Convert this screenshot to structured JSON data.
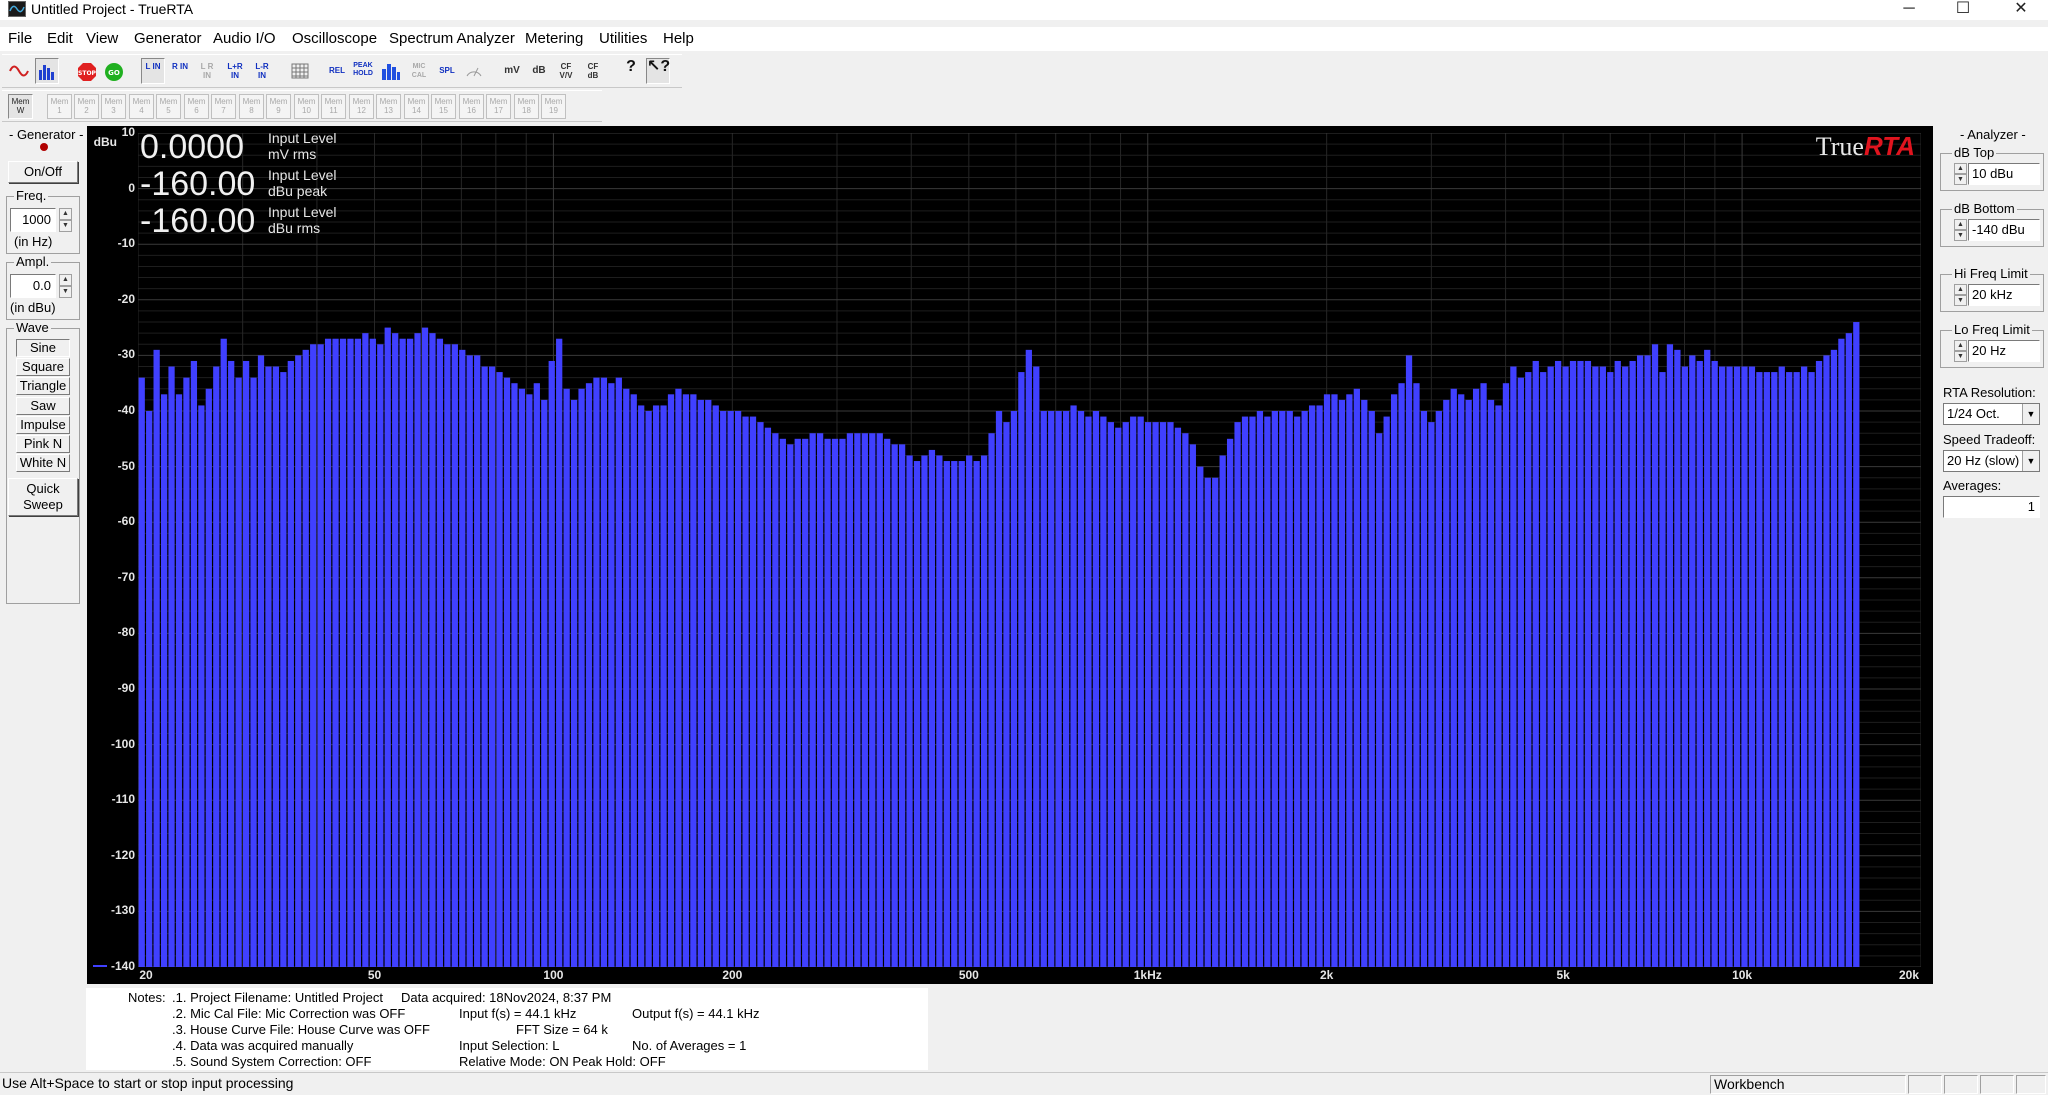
{
  "window": {
    "title": "Untitled Project - TrueRTA",
    "controls": {
      "minimize": "─",
      "maximize": "☐",
      "close": "✕"
    }
  },
  "menu": [
    "File",
    "Edit",
    "View",
    "Generator",
    "Audio I/O",
    "Oscilloscope",
    "Spectrum Analyzer",
    "Metering",
    "Utilities",
    "Help"
  ],
  "toolbar": {
    "buttons": [
      {
        "name": "osc-view-button",
        "icon": "sine-wave-icon"
      },
      {
        "name": "rta-view-button",
        "icon": "spectrum-bars-icon"
      },
      {
        "name": "stop-button",
        "label": "STOP"
      },
      {
        "name": "go-button",
        "label": "GO"
      },
      {
        "name": "l-in-button",
        "label": "L IN"
      },
      {
        "name": "r-in-button",
        "label": "R IN"
      },
      {
        "name": "l-r-in-disabled-button",
        "label": "L R IN"
      },
      {
        "name": "l-plus-r-in-button",
        "label": "L+R IN"
      },
      {
        "name": "l-minus-r-in-button",
        "label": "L-R IN"
      },
      {
        "name": "grid-button",
        "icon": "grid-icon"
      },
      {
        "name": "rel-button",
        "label": "REL"
      },
      {
        "name": "peak-hold-button",
        "label": "PEAK HOLD"
      },
      {
        "name": "bars-button",
        "icon": "bars-icon"
      },
      {
        "name": "mic-cal-button",
        "label": "MIC CAL"
      },
      {
        "name": "spl-button",
        "label": "SPL"
      },
      {
        "name": "meter-button",
        "icon": "meter-icon"
      },
      {
        "name": "mv-button",
        "label": "mV"
      },
      {
        "name": "db-button",
        "label": "dB"
      },
      {
        "name": "cf-vv-button",
        "label": "CF V/V"
      },
      {
        "name": "cf-db-button",
        "label": "CF dB"
      },
      {
        "name": "help-button",
        "icon": "question-icon"
      },
      {
        "name": "context-help-button",
        "icon": "context-help-icon"
      }
    ],
    "mem_buttons": [
      "Mem W",
      "Mem 1",
      "Mem 2",
      "Mem 3",
      "Mem 4",
      "Mem 5",
      "Mem 6",
      "Mem 7",
      "Mem 8",
      "Mem 9",
      "Mem 10",
      "Mem 11",
      "Mem 12",
      "Mem 13",
      "Mem 14",
      "Mem 15",
      "Mem 16",
      "Mem 17",
      "Mem 18",
      "Mem 19"
    ]
  },
  "generator": {
    "title": "- Generator -",
    "on_off": "On/Off",
    "freq_label": "Freq.",
    "freq_value": "1000",
    "freq_unit": "(in Hz)",
    "ampl_label": "Ampl.",
    "ampl_value": "0.0",
    "ampl_unit": "(in dBu)",
    "wave_label": "Wave",
    "waves": [
      "Sine",
      "Square",
      "Triangle",
      "Saw",
      "Impulse",
      "Pink N",
      "White N"
    ],
    "selected_wave": "Sine",
    "quick_sweep": "Quick Sweep"
  },
  "readouts": [
    {
      "value": "0.0000",
      "label1": "Input Level",
      "label2": "mV rms"
    },
    {
      "value": "-160.00",
      "label1": "Input Level",
      "label2": "dBu peak"
    },
    {
      "value": "-160.00",
      "label1": "Input Level",
      "label2": "dBu rms"
    }
  ],
  "logo": {
    "part1": "True",
    "part2": "RTA"
  },
  "colors": {
    "bars": "#4040ff",
    "plot_bg": "#000000",
    "logo_accent": "#e0141e"
  },
  "analyzer": {
    "title": "- Analyzer -",
    "db_top_label": "dB Top",
    "db_top": "10 dBu",
    "db_bottom_label": "dB Bottom",
    "db_bottom": "-140 dBu",
    "hi_freq_label": "Hi Freq Limit",
    "hi_freq": "20 kHz",
    "lo_freq_label": "Lo Freq Limit",
    "lo_freq": "20 Hz",
    "resolution_label": "RTA Resolution:",
    "resolution": "1/24 Oct.",
    "speed_label": "Speed Tradeoff:",
    "speed": "20 Hz (slow)",
    "averages_label": "Averages:",
    "averages": "1"
  },
  "chart_data": {
    "type": "bar",
    "ylabel": "dBu",
    "ylim": [
      -140,
      10
    ],
    "xlim": [
      20,
      20000
    ],
    "x_scale": "log",
    "grid": true,
    "y_ticks": [
      "10",
      "0",
      "-10",
      "-20",
      "-30",
      "-40",
      "-50",
      "-60",
      "-70",
      "-80",
      "-90",
      "-100",
      "-110",
      "-120",
      "-130",
      "-140"
    ],
    "x_ticks": [
      {
        "label": "20",
        "f": 20
      },
      {
        "label": "50",
        "f": 50
      },
      {
        "label": "100",
        "f": 100
      },
      {
        "label": "200",
        "f": 200
      },
      {
        "label": "500",
        "f": 500
      },
      {
        "label": "1kHz",
        "f": 1000
      },
      {
        "label": "2k",
        "f": 2000
      },
      {
        "label": "5k",
        "f": 5000
      },
      {
        "label": "10k",
        "f": 10000
      },
      {
        "label": "20k",
        "f": 20000
      }
    ],
    "bands_per_octave": 24,
    "values": [
      -34,
      -40,
      -29,
      -37,
      -32,
      -37,
      -34,
      -31,
      -39,
      -36,
      -32,
      -27,
      -31,
      -34,
      -31,
      -34,
      -30,
      -32,
      -32,
      -33,
      -31,
      -30,
      -29,
      -28,
      -28,
      -27,
      -27,
      -27,
      -27,
      -27,
      -26,
      -27,
      -28,
      -25,
      -26,
      -27,
      -27,
      -26,
      -25,
      -26,
      -27,
      -28,
      -28,
      -29,
      -30,
      -30,
      -32,
      -32,
      -33,
      -34,
      -35,
      -36,
      -37,
      -35,
      -38,
      -31,
      -27,
      -36,
      -38,
      -36,
      -35,
      -34,
      -34,
      -35,
      -34,
      -36,
      -37,
      -39,
      -40,
      -39,
      -39,
      -37,
      -36,
      -37,
      -37,
      -38,
      -38,
      -39,
      -40,
      -40,
      -40,
      -41,
      -41,
      -42,
      -43,
      -44,
      -45,
      -46,
      -45,
      -45,
      -44,
      -44,
      -45,
      -45,
      -45,
      -44,
      -44,
      -44,
      -44,
      -44,
      -45,
      -46,
      -46,
      -48,
      -49,
      -48,
      -47,
      -48,
      -49,
      -49,
      -49,
      -48,
      -49,
      -48,
      -44,
      -40,
      -42,
      -40,
      -33,
      -29,
      -32,
      -40,
      -40,
      -40,
      -40,
      -39,
      -40,
      -41,
      -40,
      -41,
      -42,
      -43,
      -42,
      -41,
      -41,
      -42,
      -42,
      -42,
      -42,
      -43,
      -44,
      -46,
      -50,
      -52,
      -52,
      -48,
      -45,
      -42,
      -41,
      -41,
      -40,
      -41,
      -40,
      -40,
      -40,
      -41,
      -40,
      -39,
      -39,
      -37,
      -37,
      -38,
      -37,
      -36,
      -38,
      -40,
      -44,
      -41,
      -37,
      -35,
      -30,
      -35,
      -40,
      -42,
      -40,
      -38,
      -36,
      -37,
      -38,
      -36,
      -35,
      -38,
      -39,
      -35,
      -32,
      -34,
      -33,
      -31,
      -33,
      -32,
      -31,
      -32,
      -31,
      -31,
      -31,
      -32,
      -32,
      -33,
      -31,
      -32,
      -31,
      -30,
      -30,
      -28,
      -33,
      -28,
      -29,
      -32,
      -30,
      -31,
      -29,
      -31,
      -32,
      -32,
      -32,
      -32,
      -32,
      -33,
      -33,
      -33,
      -32,
      -33,
      -33,
      -32,
      -33,
      -31,
      -30,
      -29,
      -27,
      -26,
      -24
    ]
  },
  "notes": {
    "label": "Notes:",
    "lines": [
      [
        ".1. Project Filename: Untitled Project",
        "Data acquired: 18Nov2024, 8:37 PM",
        ""
      ],
      [
        ".2. Mic Cal File: Mic Correction was OFF",
        "Input f(s) = 44.1 kHz",
        "Output f(s) = 44.1 kHz"
      ],
      [
        ".3. House Curve File: House Curve was OFF",
        "FFT Size = 64 k",
        ""
      ],
      [
        ".4. Data was acquired manually",
        "Input Selection: L",
        "No. of Averages = 1"
      ],
      [
        ".5. Sound System Correction: OFF",
        "Relative Mode: ON  Peak Hold: OFF",
        ""
      ]
    ]
  },
  "status": {
    "hint": "Use Alt+Space to start or stop input processing",
    "mode": "Workbench"
  }
}
